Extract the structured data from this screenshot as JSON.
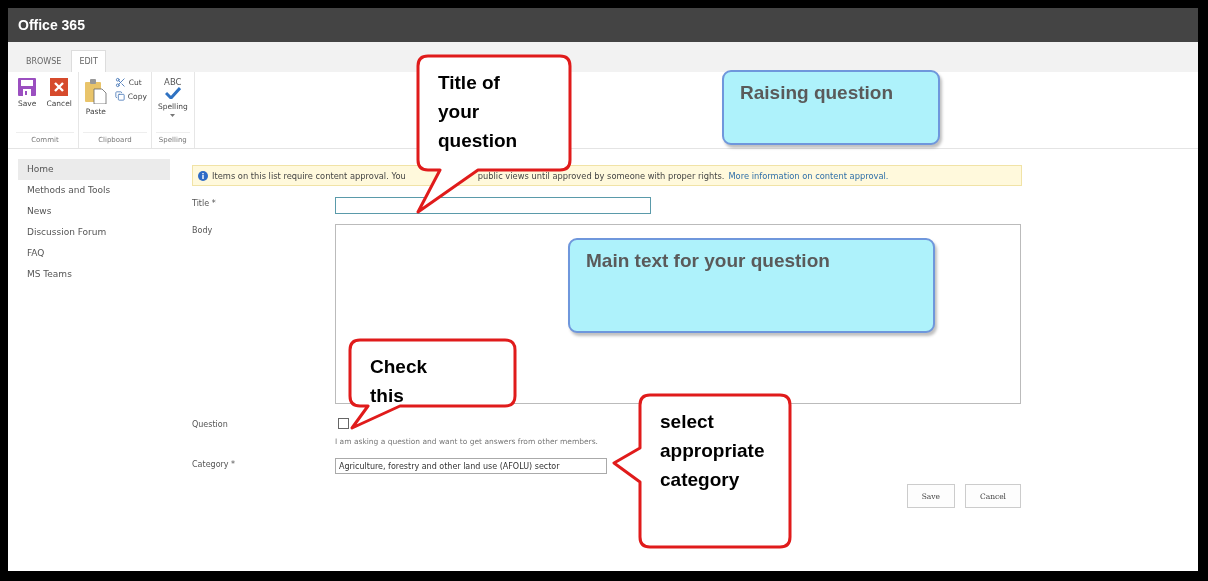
{
  "header": {
    "title": "Office 365"
  },
  "ribbon_tabs": [
    {
      "label": "BROWSE",
      "selected": false
    },
    {
      "label": "EDIT",
      "selected": true
    }
  ],
  "ribbon_groups": [
    {
      "name": "Commit",
      "buttons": [
        {
          "kind": "save",
          "label": "Save"
        },
        {
          "kind": "cancel",
          "label": "Cancel"
        }
      ]
    },
    {
      "name": "Clipboard",
      "buttons": [
        {
          "kind": "paste",
          "label": "Paste"
        },
        {
          "kind": "cut",
          "label": "Cut"
        },
        {
          "kind": "copy",
          "label": "Copy"
        }
      ]
    },
    {
      "name": "Spelling",
      "buttons": [
        {
          "kind": "spelling",
          "label": "Spelling",
          "icon_text": "ABC"
        }
      ]
    }
  ],
  "sidebar": {
    "items": [
      {
        "label": "Home",
        "selected": true
      },
      {
        "label": "Methods and Tools",
        "selected": false
      },
      {
        "label": "News",
        "selected": false
      },
      {
        "label": "Discussion Forum",
        "selected": false
      },
      {
        "label": "FAQ",
        "selected": false
      },
      {
        "label": "MS Teams",
        "selected": false
      }
    ]
  },
  "notice": {
    "text_before": "Items on this list require content approval. You",
    "text_after": "public views until approved by someone with proper rights.",
    "link": "More information on content approval."
  },
  "form": {
    "fields": [
      {
        "kind": "text",
        "label": "Title *"
      },
      {
        "kind": "richtext",
        "label": "Body"
      },
      {
        "kind": "checkbox",
        "label": "Question",
        "checked": false,
        "hint": "I am asking a question and want to get answers from other members."
      },
      {
        "kind": "select",
        "label": "Category *",
        "value": "Agriculture, forestry and other land use (AFOLU) sector"
      }
    ],
    "buttons": [
      "Save",
      "Cancel"
    ]
  },
  "callouts": [
    {
      "kind": "pointer",
      "text": "Title of your question"
    },
    {
      "kind": "note",
      "text": "Raising question"
    },
    {
      "kind": "note",
      "text": "Main text for your question"
    },
    {
      "kind": "pointer",
      "text": "Check this"
    },
    {
      "kind": "pointer",
      "text": "select appropriate category"
    }
  ]
}
